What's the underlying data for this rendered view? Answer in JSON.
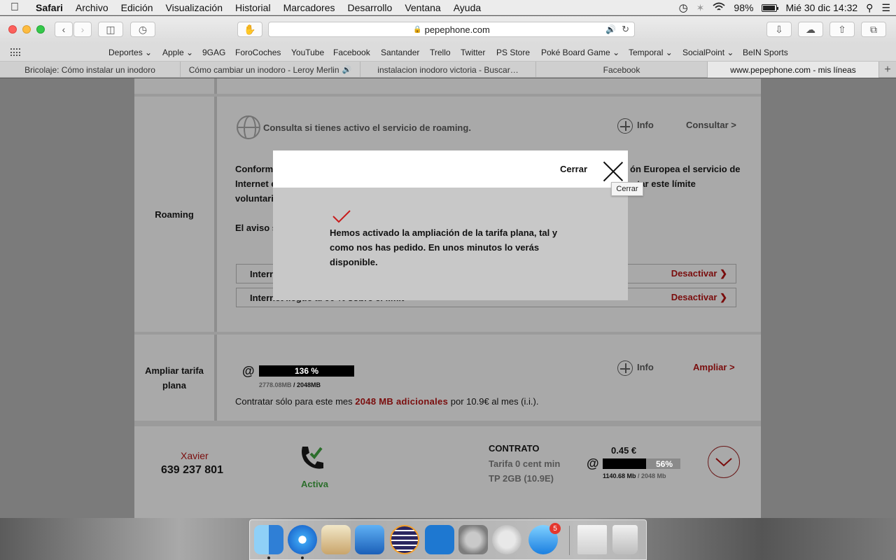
{
  "menubar": {
    "app": "Safari",
    "items": [
      "Archivo",
      "Edición",
      "Visualización",
      "Historial",
      "Marcadores",
      "Desarrollo",
      "Ventana",
      "Ayuda"
    ],
    "battery": "98%",
    "clock": "Mié 30 dic  14:32"
  },
  "toolbar": {
    "url": "pepephone.com"
  },
  "bookmarks": [
    "Deportes",
    "Apple",
    "9GAG",
    "ForoCoches",
    "YouTube",
    "Facebook",
    "Santander",
    "Trello",
    "Twitter",
    "PS Store",
    "Poké Board Game",
    "Temporal",
    "SocialPoint",
    "BeIN Sports"
  ],
  "tabs": [
    {
      "label": "Bricolaje: Cómo instalar un inodoro"
    },
    {
      "label": "Cómo cambiar un inodoro - Leroy Merlin",
      "sound": true
    },
    {
      "label": "instalacion inodoro victoria - Buscar…"
    },
    {
      "label": "Facebook"
    },
    {
      "label": "www.pepephone.com - mis líneas",
      "active": true
    }
  ],
  "roaming": {
    "label": "Roaming",
    "check_text": "Consulta si tienes activo el servicio de roaming.",
    "info_label": "Info",
    "consult_link": "Consultar >",
    "para1_left": "Conforme",
    "para1_right": "ón Europea el servicio de",
    "para2_left": "Internet e",
    "para2_right": "tar este límite",
    "para3_left": "voluntari",
    "para4_left": "El aviso s",
    "row1_left": "Intern",
    "row1_action": "Desactivar",
    "row2_left": "Internet llegue al 90 % sobre el límit",
    "row2_action": "Desactivar"
  },
  "ampliar": {
    "label_line1": "Ampliar tarifa",
    "label_line2": "plana",
    "at_symbol": "@",
    "bar_text": "136 %",
    "usage_used": "2778.08MB",
    "usage_total": " / 2048MB",
    "info_label": "Info",
    "ampliar_link": "Ampliar >",
    "offer_prefix": "Contratar sólo para este mes ",
    "offer_highlight": "2048 MB adicionales",
    "offer_suffix": " por 10.9€ al mes (i.i.)."
  },
  "line_summary": {
    "name": "Xavier",
    "number": "639 237 801",
    "status": "Activa",
    "contract_title": "CONTRATO",
    "plan_line1": "Tarifa 0 cent min",
    "plan_line2": "TP 2GB (10.9E)",
    "cost": "0.45 €",
    "at_symbol": "@",
    "bar_percent": "56%",
    "bar_fill": 0.56,
    "usage_used": "1140.68 Mb",
    "usage_total": " / 2048 Mb"
  },
  "modal": {
    "close_label": "Cerrar",
    "tooltip": "Cerrar",
    "message": "Hemos activado la ampliación de la tarifa plana, tal y como nos has pedido. En unos minutos lo verás disponible."
  },
  "dock": {
    "appstore_badge": "5"
  }
}
